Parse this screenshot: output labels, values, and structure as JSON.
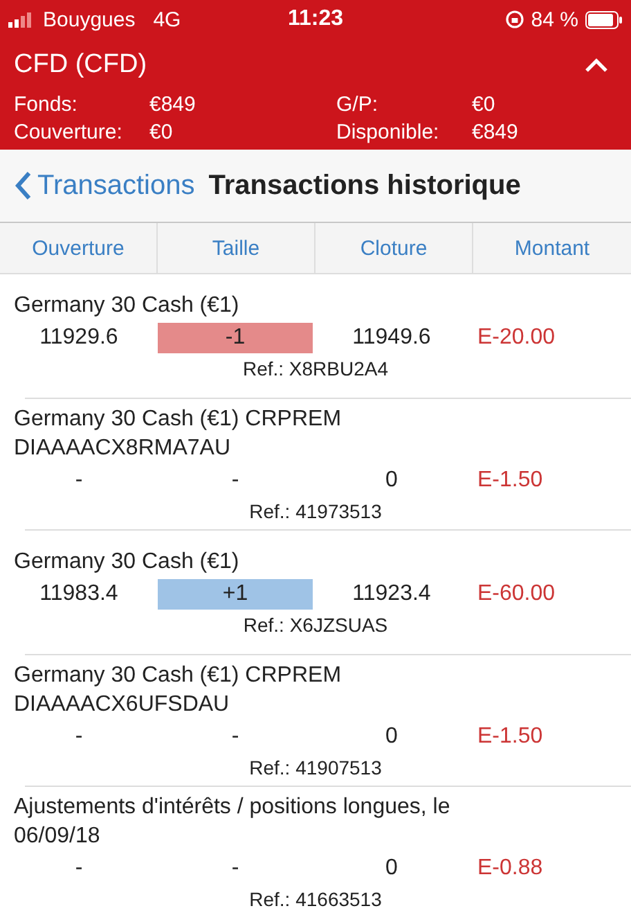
{
  "status_bar": {
    "carrier": "Bouygues",
    "network": "4G",
    "time": "11:23",
    "battery": "84 %"
  },
  "account": {
    "title": "CFD (CFD)",
    "expanded": true,
    "fields": [
      {
        "label": "Fonds:",
        "value": "€849"
      },
      {
        "label": "G/P:",
        "value": "€0"
      },
      {
        "label": "Couverture:",
        "value": "€0"
      },
      {
        "label": "Disponible:",
        "value": "€849"
      }
    ]
  },
  "nav": {
    "back": "Transactions",
    "title": "Transactions historique"
  },
  "columns": [
    "Ouverture",
    "Taille",
    "Cloture",
    "Montant"
  ],
  "rows": [
    {
      "name": "Germany 30 Cash (€1)",
      "open": "11929.6",
      "size": "-1",
      "kind": "sell",
      "close": "11949.6",
      "amount": "E-20.00",
      "ref": "Ref.: X8RBU2A4"
    },
    {
      "name": "Germany 30 Cash (€1) CRPREM DIAAAACX8RMA7AU",
      "open": "-",
      "size": "-",
      "kind": "none",
      "close": "0",
      "amount": "E-1.50",
      "ref": "Ref.: 41973513"
    },
    {
      "name": "Germany 30 Cash (€1)",
      "open": "11983.4",
      "size": "+1",
      "kind": "buy",
      "close": "11923.4",
      "amount": "E-60.00",
      "ref": "Ref.: X6JZSUAS"
    },
    {
      "name": "Germany 30 Cash (€1) CRPREM DIAAAACX6UFSDAU",
      "open": "-",
      "size": "-",
      "kind": "none",
      "close": "0",
      "amount": "E-1.50",
      "ref": "Ref.: 41907513"
    },
    {
      "name": "Ajustements d'intérêts / positions longues, le 06/09/18",
      "open": "-",
      "size": "-",
      "kind": "none",
      "close": "0",
      "amount": "E-0.88",
      "ref": "Ref.: 41663513"
    }
  ]
}
